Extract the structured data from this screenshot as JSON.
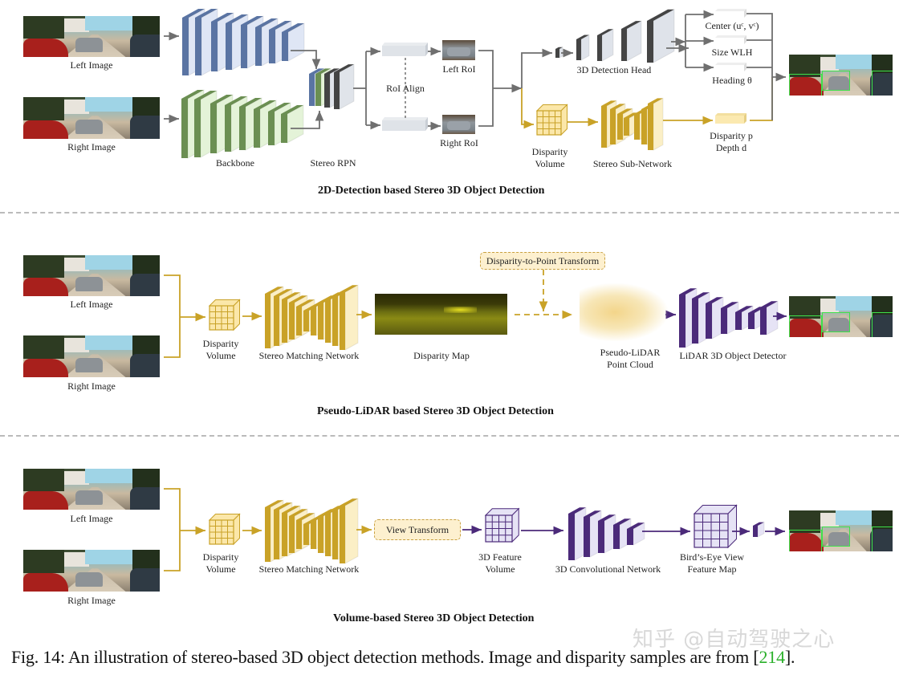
{
  "figure": {
    "caption_prefix": "Fig. 14: An illustration of stereo-based 3D object detection methods. Image and disparity samples are from [",
    "caption_ref": "214",
    "caption_suffix": "].",
    "watermark": "知乎 @自动驾驶之心",
    "colors": {
      "gray_arrow": "#6f6f6f",
      "gold": "#c9a227",
      "purple": "#4b2a7a",
      "blue_block": "#5a74a3",
      "green_block": "#6b8f52",
      "dark_block": "#444444",
      "ref_green": "#2ab02a"
    }
  },
  "panel1": {
    "title": "2D-Detection based Stereo 3D Object Detection",
    "left_image": "Left Image",
    "right_image": "Right Image",
    "backbone": "Backbone",
    "stereo_rpn": "Stereo RPN",
    "roi_align": "RoI Align",
    "left_roi": "Left RoI",
    "right_roi": "Right RoI",
    "detection_head": "3D Detection Head",
    "center": "Center (uᶜ, vᶜ)",
    "size": "Size WLH",
    "heading": "Heading θ",
    "disparity_volume_1": "Disparity",
    "disparity_volume_2": "Volume",
    "stereo_subnet": "Stereo Sub-Network",
    "disparity_p": "Disparity p",
    "depth_d": "Depth d"
  },
  "panel2": {
    "title": "Pseudo-LiDAR based Stereo 3D Object Detection",
    "left_image": "Left Image",
    "right_image": "Right Image",
    "disparity_volume_1": "Disparity",
    "disparity_volume_2": "Volume",
    "stereo_matching": "Stereo Matching Network",
    "disparity_map": "Disparity Map",
    "transform": "Disparity-to-Point Transform",
    "pseudo_lidar_1": "Pseudo-LiDAR",
    "pseudo_lidar_2": "Point Cloud",
    "lidar_detector": "LiDAR 3D Object Detector"
  },
  "panel3": {
    "title": "Volume-based Stereo 3D Object Detection",
    "left_image": "Left Image",
    "right_image": "Right Image",
    "disparity_volume_1": "Disparity",
    "disparity_volume_2": "Volume",
    "stereo_matching": "Stereo Matching Network",
    "view_transform": "View Transform",
    "feature_volume_1": "3D Feature",
    "feature_volume_2": "Volume",
    "conv3d": "3D Convolutional Network",
    "bev_1": "Bird’s-Eye View",
    "bev_2": "Feature Map"
  }
}
